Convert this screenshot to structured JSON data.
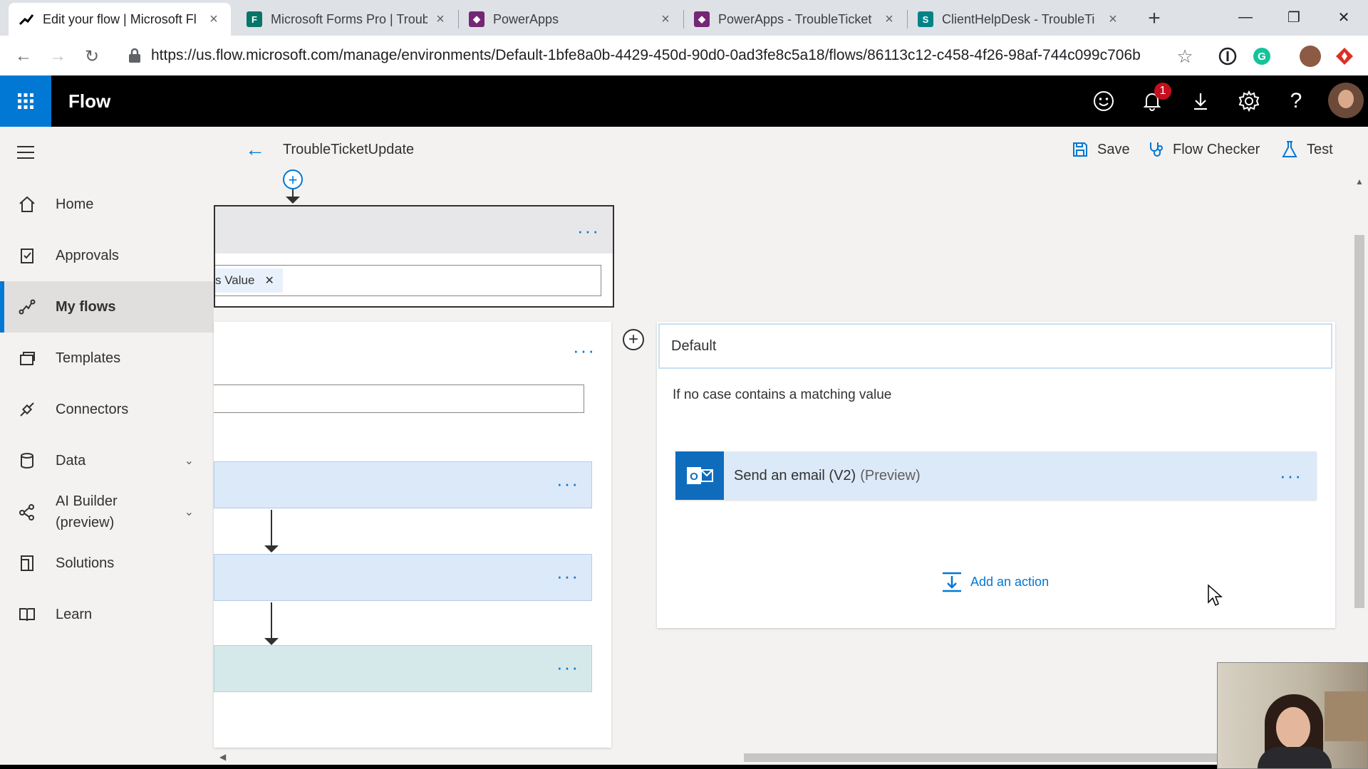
{
  "browser": {
    "tabs": [
      {
        "title": "Edit your flow | Microsoft Fl",
        "active": true,
        "icon": "flow-icon"
      },
      {
        "title": "Microsoft Forms Pro | Troub",
        "active": false,
        "icon": "forms-icon"
      },
      {
        "title": "PowerApps",
        "active": false,
        "icon": "powerapps-icon"
      },
      {
        "title": "PowerApps - TroubleTicket",
        "active": false,
        "icon": "powerapps-icon"
      },
      {
        "title": "ClientHelpDesk - TroubleTi",
        "active": false,
        "icon": "sharepoint-icon"
      }
    ],
    "url": "https://us.flow.microsoft.com/manage/environments/Default-1bfe8a0b-4429-450d-90d0-0ad3fe8c5a18/flows/86113c12-c458-4f26-98af-744c099c706b"
  },
  "app": {
    "brand": "Flow",
    "notification_count": "1",
    "accent": "#0078d4"
  },
  "sidebar": {
    "items": [
      {
        "label": "Home",
        "icon": "home-icon"
      },
      {
        "label": "Approvals",
        "icon": "approvals-icon"
      },
      {
        "label": "My flows",
        "icon": "flows-icon",
        "selected": true
      },
      {
        "label": "Templates",
        "icon": "templates-icon"
      },
      {
        "label": "Connectors",
        "icon": "connectors-icon"
      },
      {
        "label": "Data",
        "icon": "data-icon",
        "expandable": true
      },
      {
        "label": "AI Builder (preview)",
        "icon": "ai-builder-icon",
        "expandable": true
      },
      {
        "label": "Solutions",
        "icon": "solutions-icon"
      },
      {
        "label": "Learn",
        "icon": "learn-icon"
      }
    ]
  },
  "commandbar": {
    "flow_name": "TroubleTicketUpdate",
    "save_label": "Save",
    "flow_checker_label": "Flow Checker",
    "test_label": "Test"
  },
  "canvas": {
    "switch_token": "s Value",
    "default_case": {
      "title": "Default",
      "description": "If no case contains a matching value",
      "action_title": "Send an email (V2)",
      "action_tag": "(Preview)",
      "add_action_label": "Add an action"
    }
  }
}
